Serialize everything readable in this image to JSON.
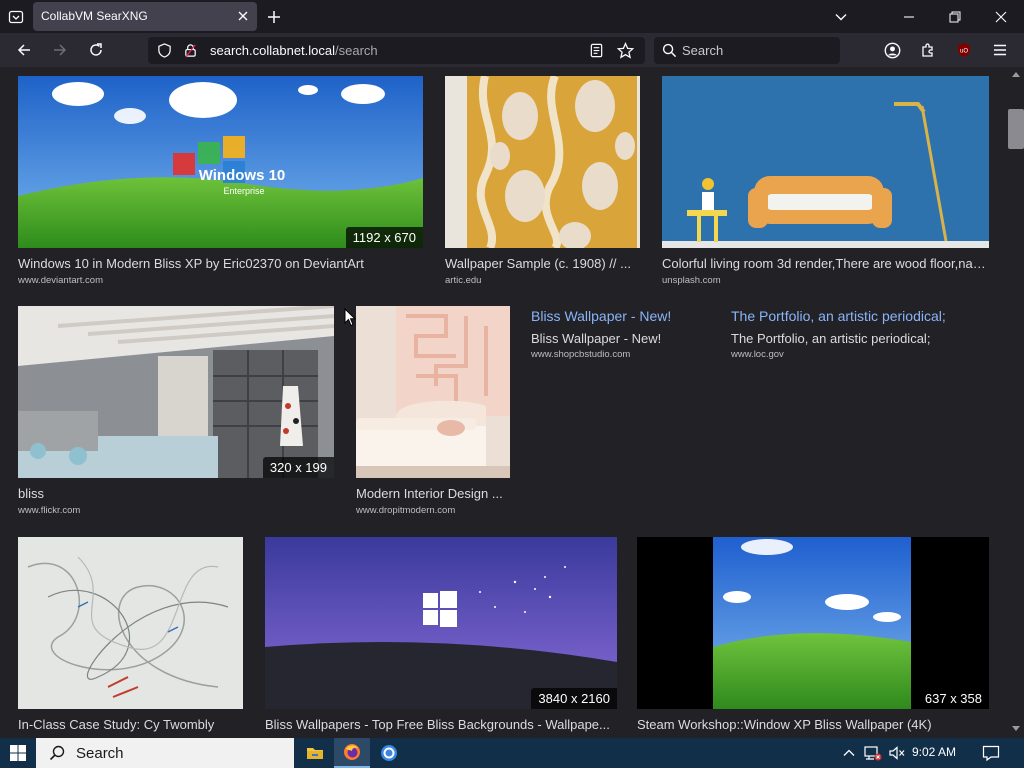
{
  "browser": {
    "tab_title": "CollabVM SearXNG",
    "url_host": "search.collabnet.local",
    "url_path": "/search",
    "search_placeholder": "Search",
    "icons": {
      "tab_list": "tab-list-icon",
      "close_tab": "close-icon",
      "new_tab": "plus-icon",
      "back": "back-arrow-icon",
      "forward": "forward-arrow-icon",
      "reload": "reload-icon",
      "tracking": "shield-icon",
      "lock": "lock-icon",
      "reader": "reader-view-icon",
      "bookmark": "star-icon",
      "account": "account-icon",
      "extensions": "extensions-icon",
      "ublock": "ublock-icon",
      "menu": "hamburger-menu-icon"
    }
  },
  "results": {
    "row1": [
      {
        "caption": "Windows 10 in Modern Bliss XP by Eric02370 on DeviantArt",
        "source": "www.deviantart.com",
        "resolution": "1192 x 670",
        "thumb_text": "Windows 10",
        "thumb_subtext": "Enterprise"
      },
      {
        "caption": "Wallpaper Sample (c. 1908) // ...",
        "source": "artic.edu"
      },
      {
        "caption": "Colorful living room 3d render,There are wood floor,navy...",
        "source": "unsplash.com"
      }
    ],
    "row2": [
      {
        "caption": "bliss",
        "source": "www.flickr.com",
        "resolution": "320 x 199"
      },
      {
        "caption": "Modern Interior Design ...",
        "source": "www.dropitmodern.com"
      }
    ],
    "text_results": [
      {
        "title": "Bliss Wallpaper - New!",
        "subtitle": "Bliss Wallpaper - New!",
        "source": "www.shopcbstudio.com"
      },
      {
        "title": "The Portfolio, an artistic periodical;",
        "subtitle": "The Portfolio, an artistic periodical;",
        "source": "www.loc.gov"
      }
    ],
    "row3": [
      {
        "caption": "In-Class Case Study: Cy Twombly",
        "source": ""
      },
      {
        "caption": "Bliss Wallpapers - Top Free Bliss Backgrounds - Wallpape...",
        "source": "",
        "resolution": "3840 x 2160"
      },
      {
        "caption": "Steam Workshop::Window XP Bliss Wallpaper (4K)",
        "source": "",
        "resolution": "637 x 358"
      }
    ]
  },
  "taskbar": {
    "search_label": "Search",
    "time": "9:02 AM",
    "colors": {
      "background": "#122f4a",
      "search_bg": "#f1f1f1"
    }
  }
}
